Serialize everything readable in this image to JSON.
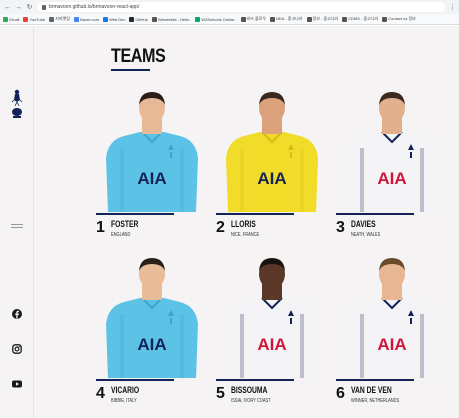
{
  "browser": {
    "url": "brmavoon.github.io/brmavoon-react-app/",
    "bookmarks": [
      {
        "label": "Gmail",
        "color": "#34a853"
      },
      {
        "label": "YouTube",
        "color": "#ea4335"
      },
      {
        "label": "지마켓팅",
        "color": "#5f6368"
      },
      {
        "label": "Naver.com",
        "color": "#4285f4"
      },
      {
        "label": "Web Dev",
        "color": "#1a73e8"
      },
      {
        "label": "GitHub",
        "color": "#24292e"
      },
      {
        "label": "Wewerella - Hello..",
        "color": "#555555"
      },
      {
        "label": "W3Schools Online..",
        "color": "#04aa6d"
      },
      {
        "label": "비즈 플로우",
        "color": "#555555"
      },
      {
        "label": "NDA - 중고나라",
        "color": "#555555"
      },
      {
        "label": "정보 - 중고나라",
        "color": "#555555"
      },
      {
        "label": "CDMS - 중고나라",
        "color": "#555555"
      },
      {
        "label": "Contact us 정보",
        "color": "#555555"
      }
    ]
  },
  "sidebar": {
    "logo": "tottenham-cockerel-logo",
    "menu_icon": "hamburger-icon",
    "social": [
      "facebook-icon",
      "instagram-icon",
      "youtube-icon"
    ]
  },
  "page": {
    "title": "TEAMS"
  },
  "colors": {
    "navy": "#132257",
    "gk_blue": "#5cc3e6",
    "gk_yellow": "#f2dc2a",
    "home_white": "#f4f4f6",
    "sponsor_red": "#d0153a"
  },
  "players": [
    {
      "number": "1",
      "name": "FOSTER",
      "place": "ENGLAND",
      "kit": "blue"
    },
    {
      "number": "2",
      "name": "LLORIS",
      "place": "NICE, FRANCE",
      "kit": "yellow"
    },
    {
      "number": "3",
      "name": "DAVIES",
      "place": "NEATH, WALES",
      "kit": "white"
    },
    {
      "number": "4",
      "name": "VICARIO",
      "place": "BIBBIE, ITALY",
      "kit": "blue"
    },
    {
      "number": "5",
      "name": "BISSOUMA",
      "place": "ISSIA, IVORY COAST",
      "kit": "white"
    },
    {
      "number": "6",
      "name": "VAN DE VEN",
      "place": "WINNER, NETHERLANDS",
      "kit": "white"
    }
  ],
  "sponsor_text": "AIA"
}
